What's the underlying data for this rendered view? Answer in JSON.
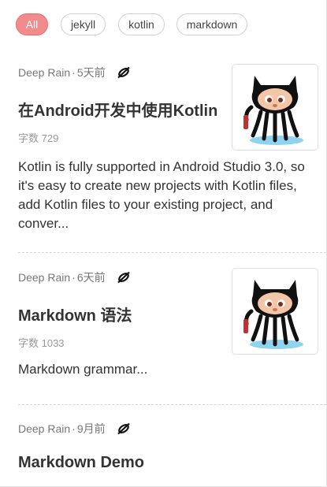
{
  "tags": [
    {
      "label": "All",
      "active": true
    },
    {
      "label": "jekyll",
      "active": false
    },
    {
      "label": "kotlin",
      "active": false
    },
    {
      "label": "markdown",
      "active": false
    }
  ],
  "articles": [
    {
      "author": "Deep Rain",
      "separator": "·",
      "time": "5天前",
      "title": "在Android开发中使用Kotlin",
      "word_count": "字数 729",
      "excerpt": "Kotlin is fully supported in Android Studio 3.0, so it's easy to create new projects with Kotlin files, add Kotlin files to your existing project, and conver...",
      "thumbnail_icon": "octocat-icon"
    },
    {
      "author": "Deep Rain",
      "separator": "·",
      "time": "6天前",
      "title": "Markdown 语法",
      "word_count": "字数 1033",
      "excerpt": "Markdown grammar...",
      "thumbnail_icon": "octocat-icon"
    },
    {
      "author": "Deep Rain",
      "separator": "·",
      "time": "9月前",
      "title": "Markdown Demo"
    }
  ],
  "colors": {
    "accent": "#f28b8b",
    "accent_border": "#ea6b6b"
  }
}
